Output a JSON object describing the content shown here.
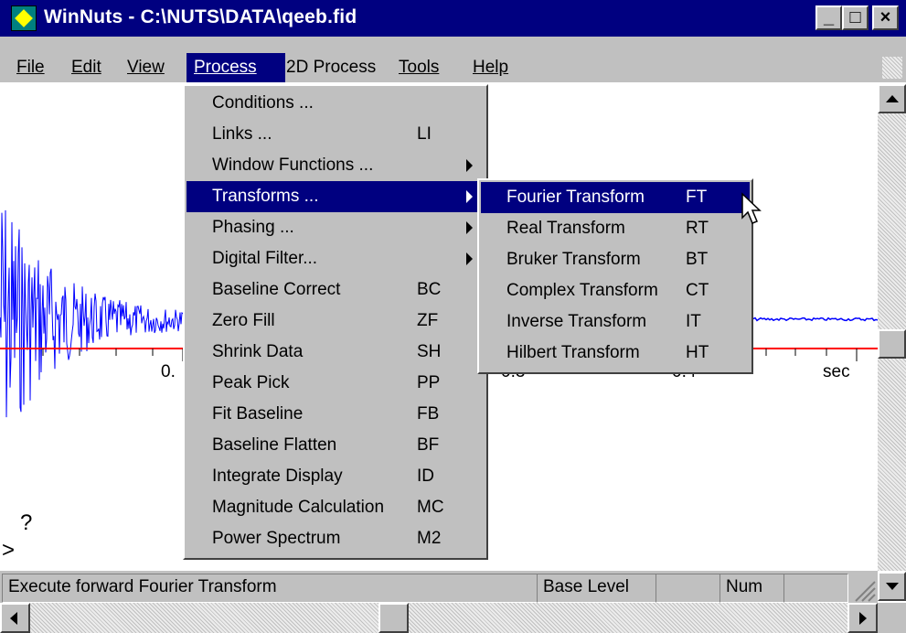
{
  "window": {
    "title": "WinNuts - C:\\NUTS\\DATA\\qeeb.fid",
    "controls": {
      "minimize": "_",
      "maximize": "□",
      "close": "×"
    }
  },
  "menubar": {
    "items": [
      "File",
      "Edit",
      "View",
      "Process",
      "2D Process",
      "Tools",
      "Help"
    ],
    "active": "Process"
  },
  "process_menu": {
    "items": [
      {
        "label": "Conditions ...",
        "shortcut": "",
        "submenu": false
      },
      {
        "label": "Links ...",
        "shortcut": "LI",
        "submenu": false
      },
      {
        "label": "Window Functions ...",
        "shortcut": "",
        "submenu": true
      },
      {
        "label": "Transforms ...",
        "shortcut": "",
        "submenu": true,
        "highlighted": true
      },
      {
        "label": "Phasing ...",
        "shortcut": "",
        "submenu": true
      },
      {
        "label": "Digital Filter...",
        "shortcut": "",
        "submenu": true
      },
      {
        "label": "Baseline Correct",
        "shortcut": "BC",
        "submenu": false
      },
      {
        "label": "Zero Fill",
        "shortcut": "ZF",
        "submenu": false
      },
      {
        "label": "Shrink Data",
        "shortcut": "SH",
        "submenu": false
      },
      {
        "label": "Peak Pick",
        "shortcut": "PP",
        "submenu": false
      },
      {
        "label": "Fit Baseline",
        "shortcut": "FB",
        "submenu": false
      },
      {
        "label": "Baseline Flatten",
        "shortcut": "BF",
        "submenu": false
      },
      {
        "label": "Integrate Display",
        "shortcut": "ID",
        "submenu": false
      },
      {
        "label": "Magnitude Calculation",
        "shortcut": "MC",
        "submenu": false
      },
      {
        "label": "Power Spectrum",
        "shortcut": "M2",
        "submenu": false
      }
    ]
  },
  "transforms_menu": {
    "items": [
      {
        "label": "Fourier Transform",
        "shortcut": "FT",
        "highlighted": true
      },
      {
        "label": "Real Transform",
        "shortcut": "RT"
      },
      {
        "label": "Bruker Transform",
        "shortcut": "BT"
      },
      {
        "label": "Complex Transform",
        "shortcut": "CT"
      },
      {
        "label": "Inverse Transform",
        "shortcut": "IT"
      },
      {
        "label": "Hilbert Transform",
        "shortcut": "HT"
      }
    ]
  },
  "plot": {
    "axis_labels": [
      "0.",
      "0.3",
      "0.4",
      "sec"
    ],
    "prompt_question": "?",
    "prompt_caret": ">",
    "trace_color": "#0000ff",
    "axis_color": "#ff0000"
  },
  "statusbar": {
    "message": "Execute forward Fourier Transform",
    "base_level_label": "Base Level",
    "num_label": "Num"
  },
  "colors": {
    "title_bar": "#000080",
    "highlight": "#000080",
    "face": "#c0c0c0"
  }
}
